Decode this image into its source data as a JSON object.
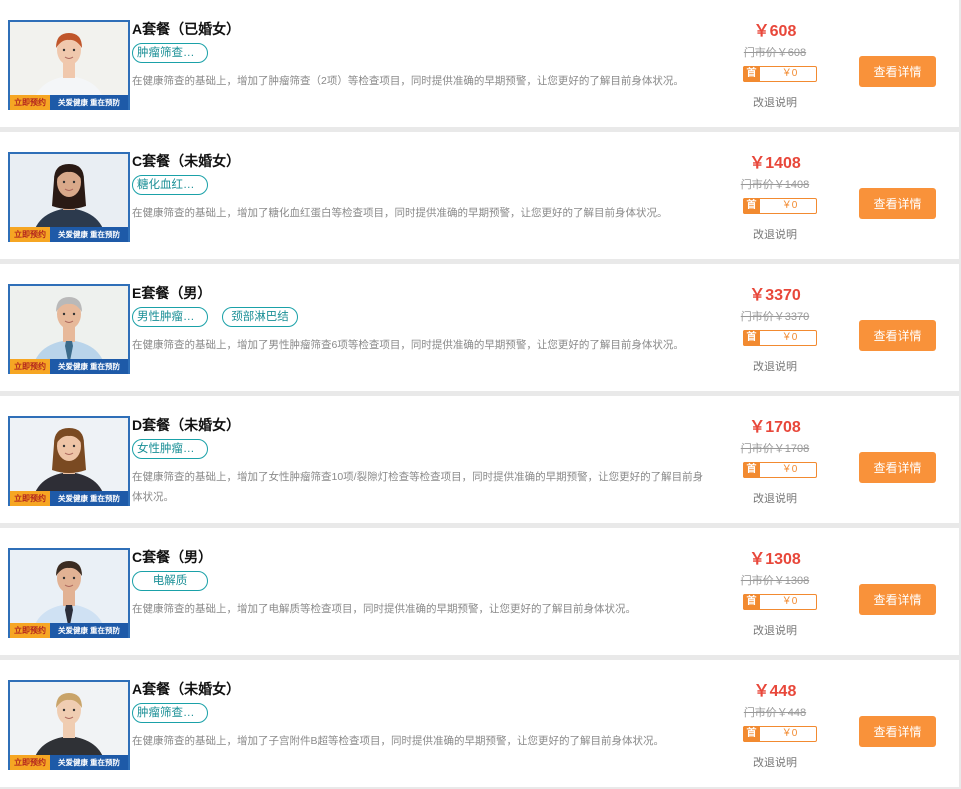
{
  "packages": [
    {
      "title": "A套餐（已婚女）",
      "tags": [
        "肿瘤筛查（2..."
      ],
      "desc": "在健康筛查的基础上，增加了肿瘤筛查（2项）等检查项目，同时提供准确的早期预警，让您更好的了解目前身体状况。",
      "price": "￥608",
      "market_price": "门市价￥608",
      "first_pay": "￥0",
      "person": "woman-redhair",
      "tone": "#f2f2ee"
    },
    {
      "title": "C套餐（未婚女）",
      "tags": [
        "糖化血红蛋白"
      ],
      "desc": "在健康筛查的基础上，增加了糖化血红蛋白等检查项目，同时提供准确的早期预警，让您更好的了解目前身体状况。",
      "price": "￥1408",
      "market_price": "门市价￥1408",
      "first_pay": "￥0",
      "person": "woman-darkhair",
      "tone": "#e9eef3"
    },
    {
      "title": "E套餐（男）",
      "tags": [
        "男性肿瘤筛...",
        "颈部淋巴结"
      ],
      "desc": "在健康筛查的基础上，增加了男性肿瘤筛查6项等检查项目，同时提供准确的早期预警，让您更好的了解目前身体状况。",
      "price": "￥3370",
      "market_price": "门市价￥3370",
      "first_pay": "￥0",
      "person": "man-grayhair",
      "tone": "#eef1ee"
    },
    {
      "title": "D套餐（未婚女）",
      "tags": [
        "女性肿瘤筛..."
      ],
      "desc": "在健康筛查的基础上，增加了女性肿瘤筛查10项/裂隙灯检查等检查项目，同时提供准确的早期预警，让您更好的了解目前身体状况。",
      "price": "￥1708",
      "market_price": "门市价￥1708",
      "first_pay": "￥0",
      "person": "woman-business",
      "tone": "#eef2f6"
    },
    {
      "title": "C套餐（男）",
      "tags": [
        "电解质"
      ],
      "desc": "在健康筛查的基础上，增加了电解质等检查项目，同时提供准确的早期预警，让您更好的了解目前身体状况。",
      "price": "￥1308",
      "market_price": "门市价￥1308",
      "first_pay": "￥0",
      "person": "man-beard",
      "tone": "#eaf0f6"
    },
    {
      "title": "A套餐（未婚女）",
      "tags": [
        "肿瘤筛查（2..."
      ],
      "desc": "在健康筛查的基础上，增加了子宫附件B超等检查项目，同时提供准确的早期预警，让您更好的了解目前身体状况。",
      "price": "￥448",
      "market_price": "门市价￥448",
      "first_pay": "￥0",
      "person": "woman-blonde",
      "tone": "#f1f3f5"
    }
  ],
  "labels": {
    "first_badge": "首",
    "refund": "改退说明",
    "detail_button": "查看详情",
    "banner_left": "立即预约",
    "banner_right": "关爱健康  重在预防"
  },
  "colors": {
    "price": "#e8473a",
    "accent": "#f9923a",
    "tag": "#1aa1a8",
    "banner": "#1e5aa8"
  }
}
